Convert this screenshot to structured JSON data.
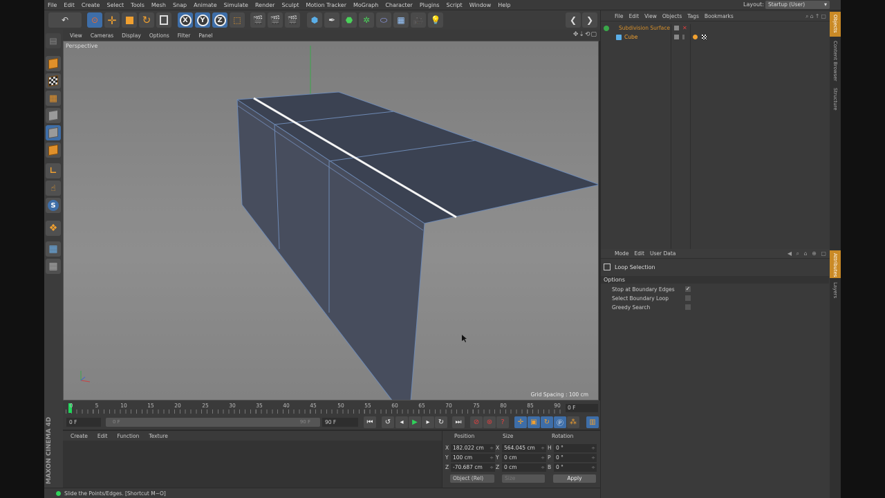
{
  "menu": [
    "File",
    "Edit",
    "Create",
    "Select",
    "Tools",
    "Mesh",
    "Snap",
    "Animate",
    "Simulate",
    "Render",
    "Sculpt",
    "Motion Tracker",
    "MoGraph",
    "Character",
    "Plugins",
    "Script",
    "Window",
    "Help"
  ],
  "layout": {
    "label": "Layout:",
    "value": "Startup (User)"
  },
  "viewport": {
    "menu": [
      "View",
      "Cameras",
      "Display",
      "Options",
      "Filter",
      "Panel"
    ],
    "camera_label": "Perspective",
    "grid_spacing": "Grid Spacing : 100 cm"
  },
  "timeline": {
    "ticks": [
      "0",
      "5",
      "10",
      "15",
      "20",
      "25",
      "30",
      "35",
      "40",
      "45",
      "50",
      "55",
      "60",
      "65",
      "70",
      "75",
      "80",
      "85",
      "90"
    ],
    "current_frame": "0 F"
  },
  "transport": {
    "start": "0 F",
    "slider_left": "0 F",
    "slider_right": "90 F",
    "end": "90 F"
  },
  "material_menu": [
    "Create",
    "Edit",
    "Function",
    "Texture"
  ],
  "coordinates": {
    "headers": [
      "Position",
      "Size",
      "Rotation"
    ],
    "rows": [
      {
        "axis": "X",
        "pos": "182.022 cm",
        "size_axis": "X",
        "size": "564.045 cm",
        "rot_axis": "H",
        "rot": "0 °"
      },
      {
        "axis": "Y",
        "pos": "100 cm",
        "size_axis": "Y",
        "size": "0 cm",
        "rot_axis": "P",
        "rot": "0 °"
      },
      {
        "axis": "Z",
        "pos": "-70.687 cm",
        "size_axis": "Z",
        "size": "0 cm",
        "rot_axis": "B",
        "rot": "0 °"
      }
    ],
    "mode": "Object (Rel)",
    "size_mode": "Size",
    "apply": "Apply"
  },
  "status": "Slide the Points/Edges. [Shortcut M~O]",
  "objects_panel": {
    "menu": [
      "File",
      "Edit",
      "View",
      "Objects",
      "Tags",
      "Bookmarks"
    ],
    "items": [
      {
        "name": "Subdivision Surface"
      },
      {
        "name": "Cube"
      }
    ]
  },
  "attributes_panel": {
    "menu": [
      "Mode",
      "Edit",
      "User Data"
    ],
    "title": "Loop Selection",
    "section": "Options",
    "options": [
      {
        "label": "Stop at Boundary Edges",
        "checked": "✓"
      },
      {
        "label": "Select Boundary Loop",
        "checked": ""
      },
      {
        "label": "Greedy Search",
        "checked": ""
      }
    ]
  },
  "side_tabs": [
    "Objects",
    "Content Browser",
    "Structure"
  ],
  "side_tabs_lower": [
    "Attributes",
    "Layers"
  ],
  "brand": "MAXON CINEMA 4D",
  "colors": {
    "accent": "#f0a030",
    "selection_blue": "#3e6ea8",
    "play_green": "#2fd35a"
  }
}
